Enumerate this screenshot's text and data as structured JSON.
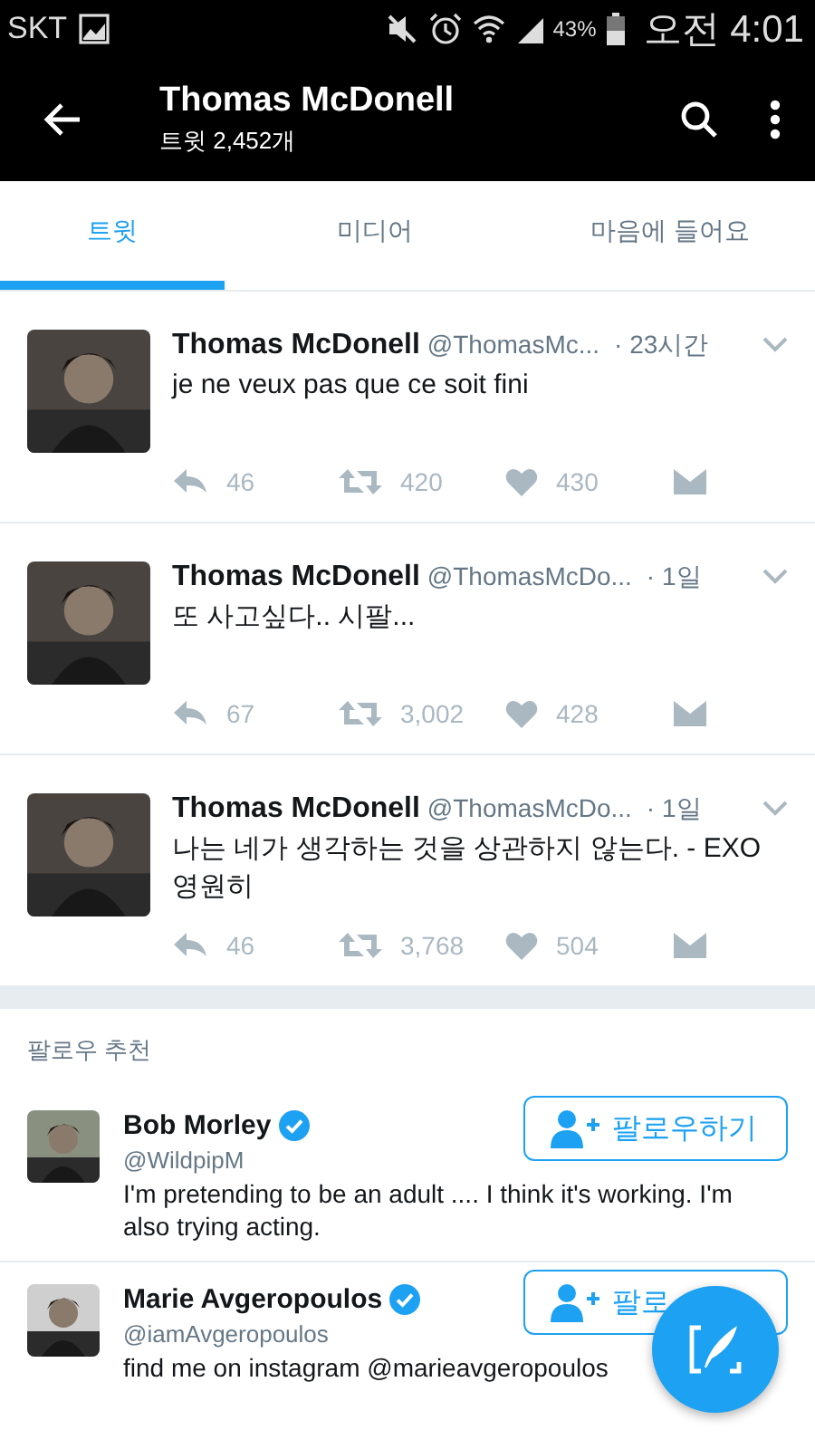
{
  "status_bar": {
    "carrier": "SKT",
    "battery_percent": "43%",
    "time": "오전 4:01"
  },
  "header": {
    "title": "Thomas McDonell",
    "subtitle": "트윗 2,452개"
  },
  "tabs": [
    {
      "label": "트윗",
      "selected": true
    },
    {
      "label": "미디어",
      "selected": false
    },
    {
      "label": "마음에 들어요",
      "selected": false
    }
  ],
  "tweets": [
    {
      "name": "Thomas McDonell",
      "handle": "@ThomasMc...",
      "time": "· 23시간",
      "text": "je ne veux pas que ce soit fini",
      "replies": "46",
      "retweets": "420",
      "likes": "430"
    },
    {
      "name": "Thomas McDonell",
      "handle": "@ThomasMcDo...",
      "time": "· 1일",
      "text": "또 사고싶다.. 시팔...",
      "replies": "67",
      "retweets": "3,002",
      "likes": "428"
    },
    {
      "name": "Thomas McDonell",
      "handle": "@ThomasMcDo...",
      "time": "· 1일",
      "text": "나는 네가 생각하는 것을 상관하지 않는다. - EXO 영원히",
      "replies": "46",
      "retweets": "3,768",
      "likes": "504"
    }
  ],
  "suggestions": {
    "title": "팔로우 추천",
    "users": [
      {
        "name": "Bob Morley",
        "verified": true,
        "handle": "@WildpipM",
        "bio": "I'm pretending to be an adult .... I think it's working. I'm also trying acting.",
        "follow_label": "팔로우하기"
      },
      {
        "name": "Marie Avgeropoulos",
        "verified": true,
        "handle": "@iamAvgeropoulos",
        "bio": "find me on instagram @marieavgeropoulos",
        "follow_label": "팔로"
      }
    ]
  }
}
